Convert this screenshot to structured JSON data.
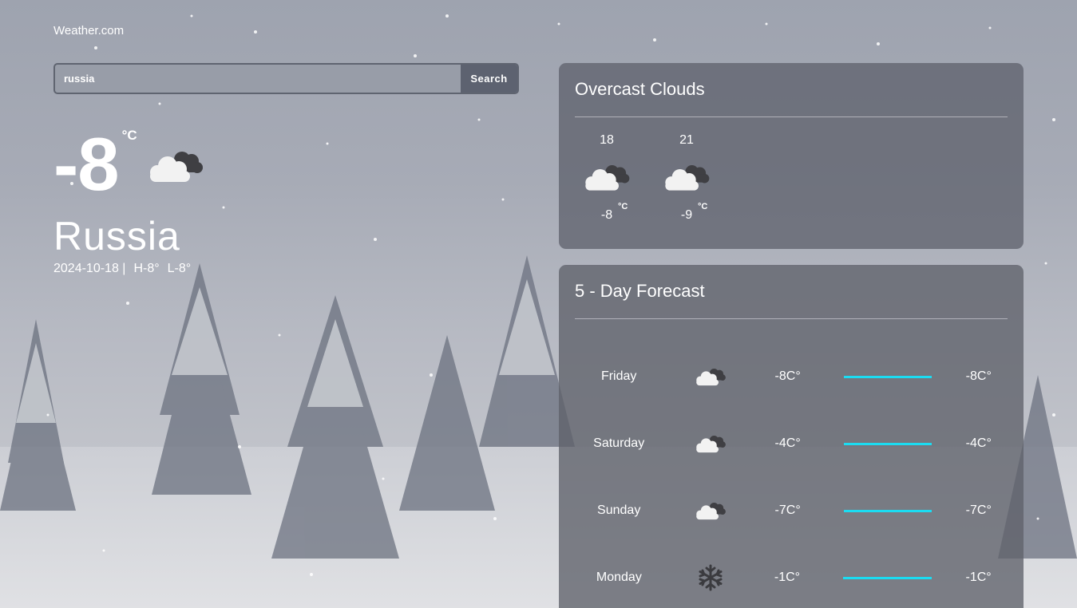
{
  "brand": "Weather.com",
  "search": {
    "value": "russia",
    "button_label": "Search"
  },
  "current": {
    "temp": "-8",
    "unit": "°C",
    "icon": "cloud-icon",
    "city": "Russia",
    "date": "2024-10-18 |",
    "high": "H-8°",
    "low": "L-8°"
  },
  "today": {
    "title": "Overcast Clouds",
    "hours": [
      {
        "time": "18",
        "icon": "cloud-icon",
        "temp": "-8",
        "unit": "°C"
      },
      {
        "time": "21",
        "icon": "cloud-icon",
        "temp": "-9",
        "unit": "°C"
      }
    ]
  },
  "forecast": {
    "title": "5 - Day Forecast",
    "bar_color": "#1bdcf2",
    "days": [
      {
        "day": "Friday",
        "icon": "cloud-icon",
        "low": "-8C°",
        "high": "-8C°"
      },
      {
        "day": "Saturday",
        "icon": "cloud-icon",
        "low": "-4C°",
        "high": "-4C°"
      },
      {
        "day": "Sunday",
        "icon": "cloud-icon",
        "low": "-7C°",
        "high": "-7C°"
      },
      {
        "day": "Monday",
        "icon": "snowflake-icon",
        "low": "-1C°",
        "high": "-1C°"
      }
    ]
  }
}
